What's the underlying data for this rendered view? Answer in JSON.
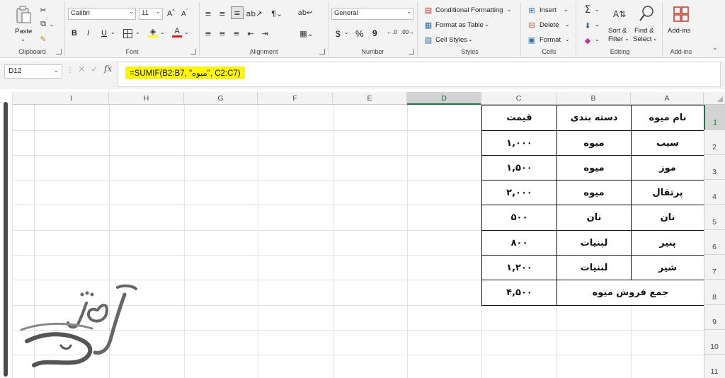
{
  "ribbon": {
    "clipboard": {
      "group_label": "Clipboard",
      "paste": "Paste"
    },
    "font": {
      "group_label": "Font",
      "font_name": "Calibri",
      "font_size": "11",
      "bold": "B",
      "italic": "I",
      "underline": "U",
      "grow": "A^",
      "shrink": "Aˇ"
    },
    "alignment": {
      "group_label": "Alignment"
    },
    "number": {
      "group_label": "Number",
      "format": "General",
      "currency": "$",
      "percent": "%",
      "comma": "9"
    },
    "styles": {
      "group_label": "Styles",
      "conditional": "Conditional Formatting",
      "format_table": "Format as Table",
      "cell_styles": "Cell Styles"
    },
    "cells": {
      "group_label": "Cells",
      "insert": "Insert",
      "delete": "Delete",
      "format": "Format"
    },
    "editing": {
      "group_label": "Editing",
      "sort_filter_1": "Sort &",
      "sort_filter_2": "Filter",
      "find_select_1": "Find &",
      "find_select_2": "Select"
    },
    "addins": {
      "group_label": "Add-ins",
      "addins": "Add-ins"
    }
  },
  "formula_bar": {
    "name_box": "D12",
    "fx": "fx",
    "formula": "=SUMIF(B2:B7, \"میوه\", C2:C7)"
  },
  "columns": [
    "I",
    "H",
    "G",
    "F",
    "E",
    "D",
    "C",
    "B",
    "A"
  ],
  "rows": [
    "1",
    "2",
    "3",
    "4",
    "5",
    "6",
    "7",
    "8",
    "9",
    "10",
    "11"
  ],
  "table": {
    "headers": {
      "a": "نام میوه",
      "b": "دسته بندی",
      "c": "قیمت"
    },
    "rows": [
      {
        "a": "سیب",
        "b": "میوه",
        "c": "۱,۰۰۰"
      },
      {
        "a": "موز",
        "b": "میوه",
        "c": "۱,۵۰۰"
      },
      {
        "a": "پرتقال",
        "b": "میوه",
        "c": "۲,۰۰۰"
      },
      {
        "a": "نان",
        "b": "نان",
        "c": "۵۰۰"
      },
      {
        "a": "پنیر",
        "b": "لبنیات",
        "c": "۸۰۰"
      },
      {
        "a": "شیر",
        "b": "لبنیات",
        "c": "۱,۲۰۰"
      }
    ],
    "total_label": "جمع فروش میوه",
    "total_value": "۴,۵۰۰"
  },
  "logo": {
    "name": "آرسی طوسی"
  }
}
